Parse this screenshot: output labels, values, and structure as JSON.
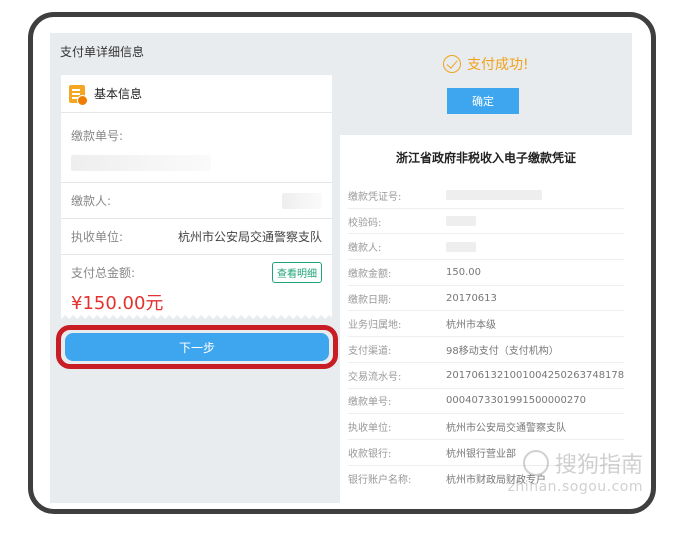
{
  "left": {
    "title": "支付单详细信息",
    "card_header": "基本信息",
    "payment_no_label": "缴款单号:",
    "payer_label": "缴款人:",
    "unit_label": "执收单位:",
    "unit_value": "杭州市公安局交通警察支队",
    "total_label": "支付总金额:",
    "detail_button": "查看明细",
    "amount": "¥150.00元",
    "next_button": "下一步"
  },
  "right": {
    "success_text": "支付成功!",
    "confirm_button": "确定",
    "receipt_title": "浙江省政府非税收入电子缴款凭证",
    "rows": [
      {
        "label": "缴款凭证号:",
        "value": ""
      },
      {
        "label": "校验码:",
        "value": ""
      },
      {
        "label": "缴款人:",
        "value": ""
      },
      {
        "label": "缴款金额:",
        "value": "150.00"
      },
      {
        "label": "缴款日期:",
        "value": "20170613"
      },
      {
        "label": "业务归属地:",
        "value": "杭州市本级"
      },
      {
        "label": "支付渠道:",
        "value": "98移动支付（支付机构）"
      },
      {
        "label": "交易流水号:",
        "value": "2017061321001004250263748178"
      },
      {
        "label": "缴款单号:",
        "value": "0004073301991500000270"
      },
      {
        "label": "执收单位:",
        "value": "杭州市公安局交通警察支队"
      },
      {
        "label": "收款银行:",
        "value": "杭州银行营业部"
      },
      {
        "label": "银行账户名称:",
        "value": "杭州市财政局财政专户"
      }
    ]
  },
  "watermark": {
    "brand": "搜狗指南",
    "domain": "zhinan.sogou.com"
  },
  "colors": {
    "primary_blue": "#3ea6ef",
    "success_orange": "#f0a21b",
    "amount_red": "#e2332f",
    "highlight_red": "#c81d25",
    "detail_green": "#1fa47a"
  }
}
